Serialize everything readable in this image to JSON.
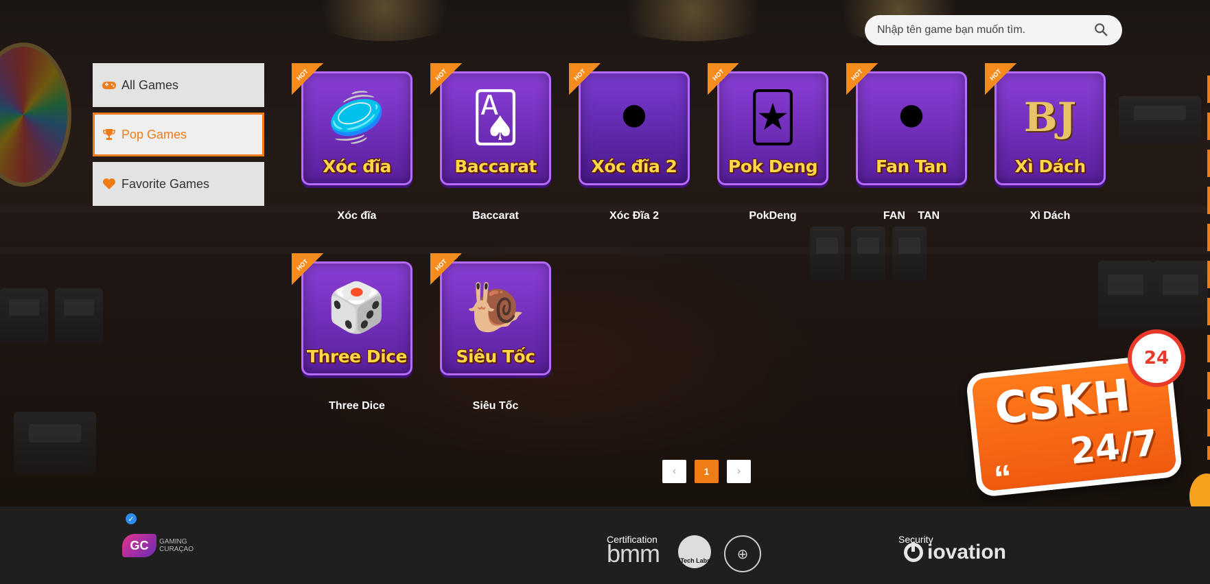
{
  "search": {
    "placeholder": "Nhập tên game bạn muốn tìm."
  },
  "sidebar": {
    "items": [
      {
        "label": "All Games",
        "icon": "gamepad-icon",
        "active": false
      },
      {
        "label": "Pop Games",
        "icon": "trophy-icon",
        "active": true
      },
      {
        "label": "Favorite Games",
        "icon": "heart-icon",
        "active": false
      }
    ]
  },
  "games": [
    {
      "tile_title": "Xóc đĩa",
      "name": "Xóc đĩa",
      "badge": "HOT",
      "art": "🥏"
    },
    {
      "tile_title": "Baccarat",
      "name": "Baccarat",
      "badge": "HOT",
      "art": "🂡"
    },
    {
      "tile_title": "Xóc đĩa 2",
      "name": "Xóc Đĩa 2",
      "badge": "HOT",
      "art": "⚫"
    },
    {
      "tile_title": "Pok Deng",
      "name": "PokDeng",
      "badge": "HOT",
      "art": "🃏"
    },
    {
      "tile_title": "Fan Tan",
      "name": "FAN TAN",
      "badge": "HOT",
      "art": "⚫"
    },
    {
      "tile_title": "Xì Dách",
      "name": "Xì Dách",
      "badge": "HOT",
      "art": "BJ"
    },
    {
      "tile_title": "Three Dice",
      "name": "Three Dice",
      "badge": "HOT",
      "art": "🎲"
    },
    {
      "tile_title": "Siêu Tốc",
      "name": "Siêu Tốc",
      "badge": "HOT",
      "art": "🐌"
    }
  ],
  "pagination": {
    "prev": "‹",
    "current": "1",
    "next": "›"
  },
  "cskh": {
    "title": "CSKH",
    "subtitle": "24/7",
    "clock_text": "24",
    "quote": "“"
  },
  "footer": {
    "certification_label": "Certification",
    "security_label": "Security",
    "gc_badge": "GC",
    "gc_text_1": "Gaming",
    "gc_text_2": "Curaçao",
    "bmm": "bmm",
    "itech": "iTech Labs",
    "iovation": "iovation"
  },
  "colors": {
    "accent": "#f07c16",
    "tile_purple": "#6a28b8",
    "tile_title": "#ffd84a",
    "footer_bg": "#1f1f1f"
  }
}
